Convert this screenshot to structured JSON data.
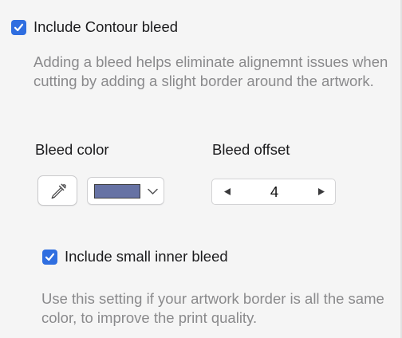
{
  "contour_bleed": {
    "label": "Include Contour bleed",
    "checked": true,
    "help": "Adding a bleed helps eliminate alignemnt issues when cutting by adding a slight border around the artwork."
  },
  "bleed_color": {
    "label": "Bleed color",
    "swatch_color": "#6672a4",
    "eyedropper_icon": "eyedropper-icon",
    "dropdown_icon": "chevron-down-icon"
  },
  "bleed_offset": {
    "label": "Bleed offset",
    "value": "4",
    "decrement_icon": "triangle-left-icon",
    "increment_icon": "triangle-right-icon"
  },
  "inner_bleed": {
    "label": "Include small inner bleed",
    "checked": true,
    "help": "Use this setting if your artwork border is all the same color, to improve the print quality."
  },
  "colors": {
    "accent": "#2f6ee0",
    "help_text": "#8a8a8c",
    "background": "#f5f5f5"
  }
}
